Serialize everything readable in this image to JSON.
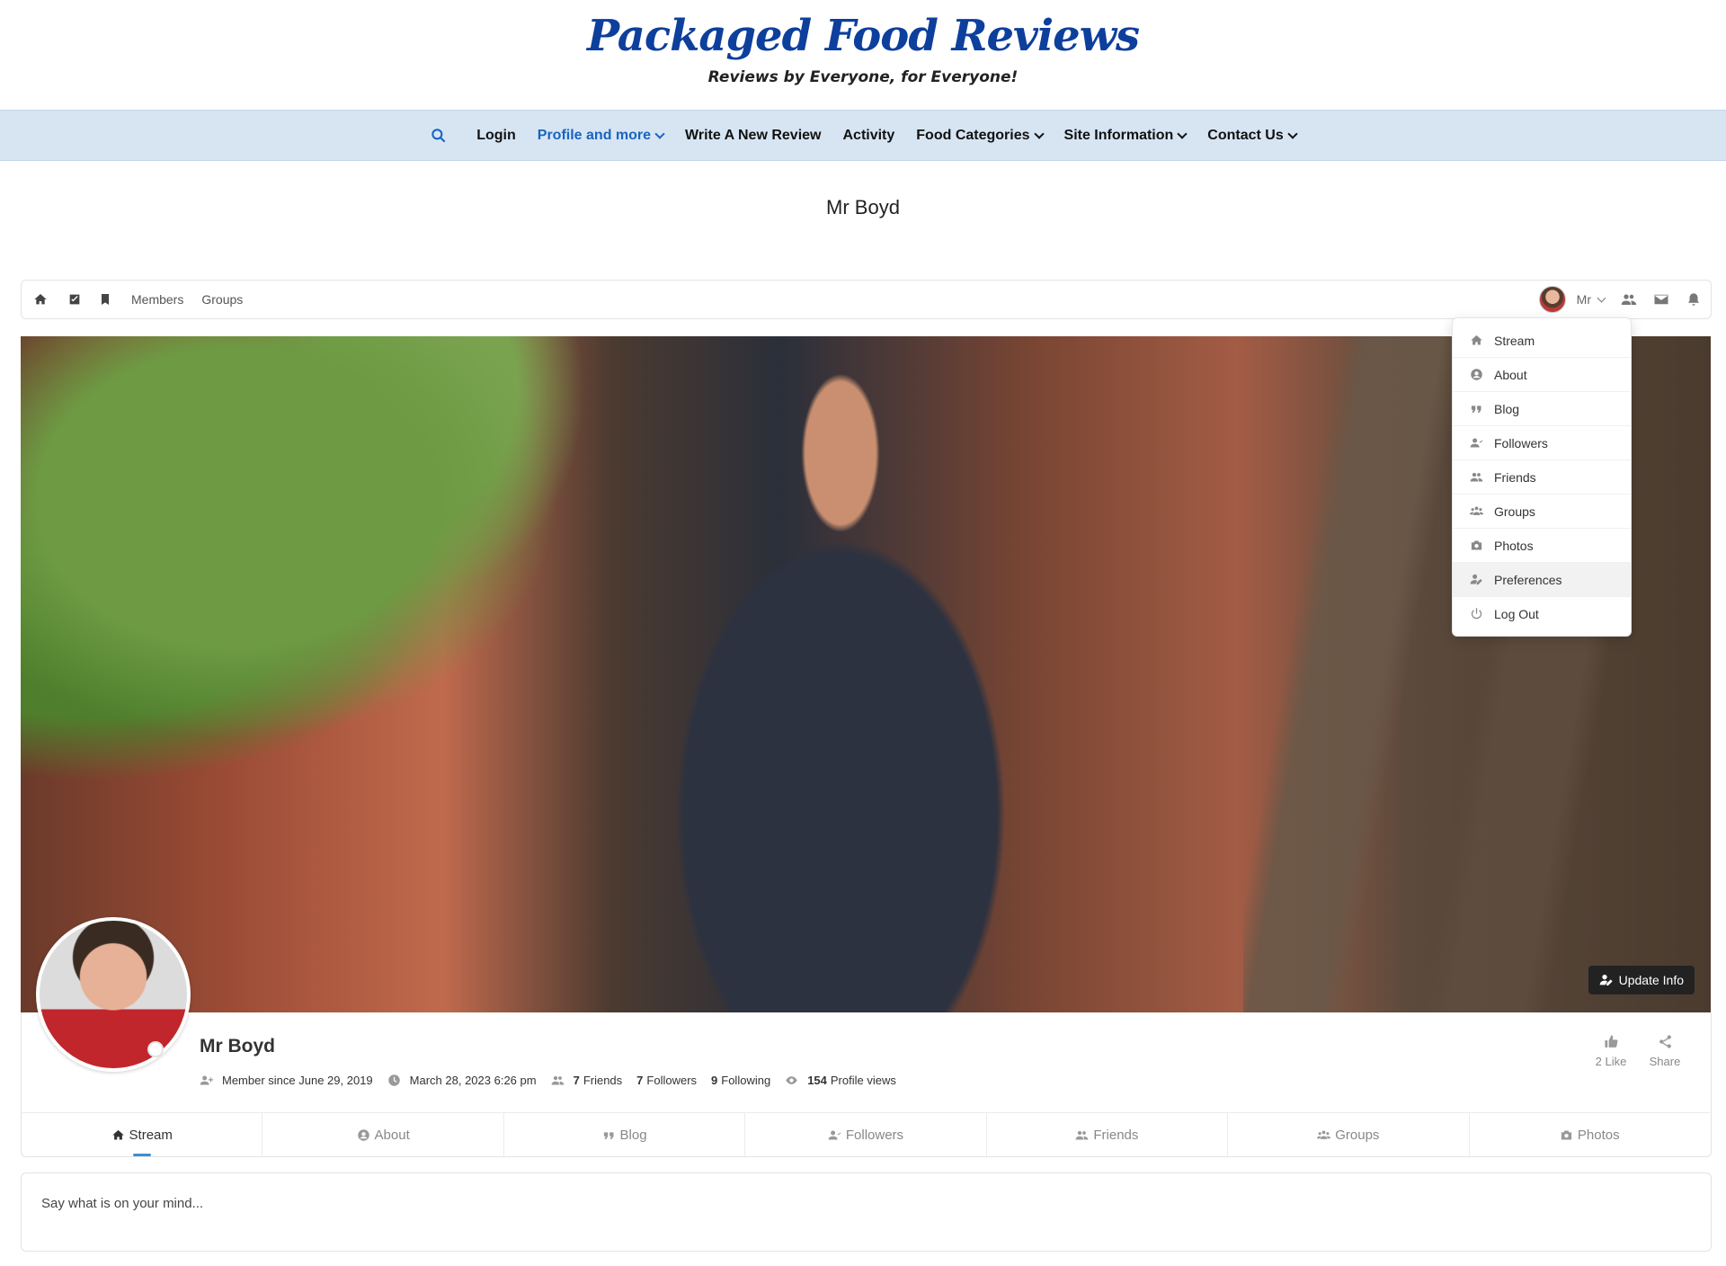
{
  "site": {
    "title": "Packaged Food Reviews",
    "tagline": "Reviews by Everyone, for Everyone!"
  },
  "nav": {
    "items": [
      {
        "label": "Login"
      },
      {
        "label": "Profile and more"
      },
      {
        "label": "Write A New Review"
      },
      {
        "label": "Activity"
      },
      {
        "label": "Food Categories"
      },
      {
        "label": "Site Information"
      },
      {
        "label": "Contact Us"
      }
    ],
    "active_color": "#1a64c0"
  },
  "page": {
    "title": "Mr Boyd"
  },
  "toolbar": {
    "links": [
      "Members",
      "Groups"
    ],
    "user_label": "Mr"
  },
  "dropdown": {
    "items": [
      {
        "label": "Stream",
        "icon": "home-icon"
      },
      {
        "label": "About",
        "icon": "user-circle-icon"
      },
      {
        "label": "Blog",
        "icon": "quote-icon"
      },
      {
        "label": "Followers",
        "icon": "user-check-icon"
      },
      {
        "label": "Friends",
        "icon": "users-icon"
      },
      {
        "label": "Groups",
        "icon": "group-icon"
      },
      {
        "label": "Photos",
        "icon": "camera-icon"
      },
      {
        "label": "Preferences",
        "icon": "user-edit-icon"
      },
      {
        "label": "Log Out",
        "icon": "power-icon"
      }
    ]
  },
  "cover": {
    "update_label": "Update Info"
  },
  "profile": {
    "name": "Mr Boyd",
    "member_since": "Member since June 29, 2019",
    "last_active": "March 28, 2023 6:26 pm",
    "friends_count": "7",
    "friends_label": "Friends",
    "followers_count": "7",
    "followers_label": "Followers",
    "following_count": "9",
    "following_label": "Following",
    "views_count": "154",
    "views_label": "Profile views",
    "like_label": "2 Like",
    "share_label": "Share"
  },
  "tabs": [
    {
      "label": "Stream",
      "active": true
    },
    {
      "label": "About"
    },
    {
      "label": "Blog"
    },
    {
      "label": "Followers"
    },
    {
      "label": "Friends"
    },
    {
      "label": "Groups"
    },
    {
      "label": "Photos"
    }
  ],
  "composer": {
    "placeholder": "Say what is on your mind..."
  }
}
